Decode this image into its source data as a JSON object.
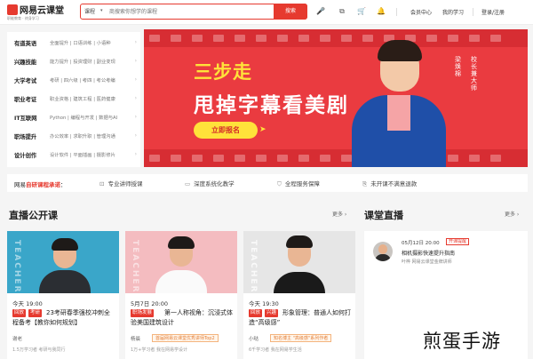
{
  "header": {
    "logo_text": "网易云课堂",
    "logo_sub": "职能教育 · 终身学习",
    "search_category": "课程",
    "search_placeholder": "商搜索你想学的课程",
    "search_button": "搜索",
    "links": [
      "会员中心",
      "我的学习",
      "登录/注册"
    ]
  },
  "sidebar": {
    "items": [
      {
        "cat": "有道英语",
        "sub": "全面提升 | 口语训练 | 小语种"
      },
      {
        "cat": "兴趣技能",
        "sub": "能力提升 | 投资理财 | 副业变现"
      },
      {
        "cat": "大学考试",
        "sub": "考研 | 四六级 | 考四 | 考公考编"
      },
      {
        "cat": "职业考证",
        "sub": "职业资格 | 建筑工程 | 医药健康"
      },
      {
        "cat": "IT互联网",
        "sub": "Python | 编程与开发 | 数据与AI"
      },
      {
        "cat": "职场提升",
        "sub": "办公效率 | 求职升职 | 管理沟通"
      },
      {
        "cat": "设计创作",
        "sub": "设计软件 | 平面插画 | 摄影修片"
      }
    ]
  },
  "banner": {
    "line1": "三步走",
    "line2": "甩掉字幕看美剧",
    "cta": "立即报名",
    "name": "梁焕棉",
    "title": "校长兼大师"
  },
  "promise": {
    "title_prefix": "网易",
    "title_highlight": "自研课程承诺",
    "title_suffix": "：",
    "items": [
      "专业讲师授课",
      "深度系统化教学",
      "全程服务保障",
      "未开课不满意退款"
    ]
  },
  "live_section": {
    "title": "直播公开课",
    "more": "更多",
    "cards": [
      {
        "watermark": "TEACHER",
        "time": "今天 19:00",
        "tag1": "回放",
        "tag2": "考研",
        "text": "23考研春季强校冲刺全程备考【教你如何规划】",
        "teacher": "谢老",
        "badge": "",
        "count": "1.5万学习者 考研与我同行"
      },
      {
        "watermark": "TEACHER",
        "time": "5月7日 20:00",
        "tag1": "",
        "tag2": "职场发展",
        "text": "第一人称视角：沉浸式体验美国建筑设计",
        "teacher": "杨晨",
        "badge": "首届网易云课堂优秀讲师Top2",
        "count": "1万+学习者 我在网易学设计"
      },
      {
        "watermark": "TEACHER",
        "time": "今天 19:30",
        "tag1": "回放",
        "tag2": "兴趣",
        "text": "形象管理：普通人如何打造“高级感”",
        "teacher": "小哒",
        "badge": "知名博主 \"高级感\"系列作者",
        "count": "6千学习者 我在网易学生活"
      }
    ]
  },
  "classroom": {
    "title": "课堂直播",
    "more": "更多",
    "item": {
      "time": "05月12日 20:00",
      "state": "开课提醒",
      "title": "相机摄影快速提升指南",
      "sub": "叶桦 网易云课堂金牌讲师"
    }
  },
  "watermark": "煎蛋手游",
  "colors": {
    "brand": "#e63a2f",
    "banner_bg": "#ea3b40",
    "banner_yellow": "#ffe23a"
  }
}
